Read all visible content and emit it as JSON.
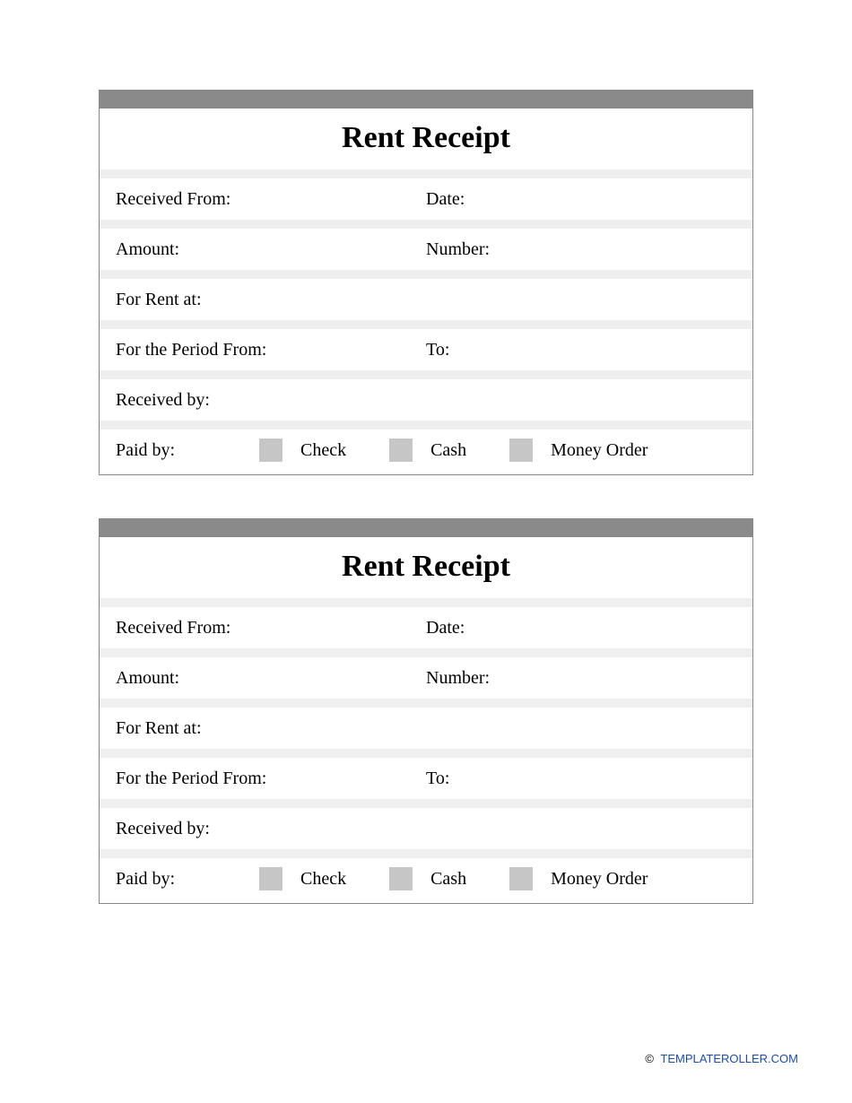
{
  "receipts": [
    {
      "title": "Rent Receipt",
      "received_from_label": "Received From:",
      "date_label": "Date:",
      "amount_label": "Amount:",
      "number_label": "Number:",
      "for_rent_at_label": "For Rent at:",
      "period_from_label": "For the Period From:",
      "period_to_label": "To:",
      "received_by_label": "Received by:",
      "paid_by_label": "Paid by:",
      "option_check": "Check",
      "option_cash": "Cash",
      "option_money_order": "Money Order"
    },
    {
      "title": "Rent Receipt",
      "received_from_label": "Received From:",
      "date_label": "Date:",
      "amount_label": "Amount:",
      "number_label": "Number:",
      "for_rent_at_label": "For Rent at:",
      "period_from_label": "For the Period From:",
      "period_to_label": "To:",
      "received_by_label": "Received by:",
      "paid_by_label": "Paid by:",
      "option_check": "Check",
      "option_cash": "Cash",
      "option_money_order": "Money Order"
    }
  ],
  "footer": {
    "copyright": "©",
    "site": "TEMPLATEROLLER.COM"
  }
}
